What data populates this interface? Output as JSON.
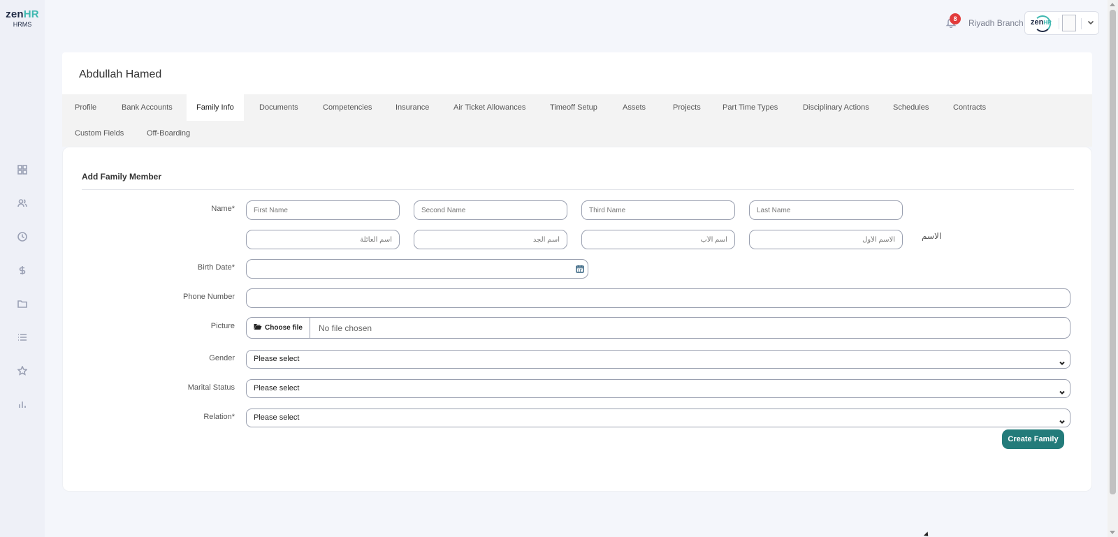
{
  "brand": {
    "logo_main": "zen",
    "logo_accent": "HR",
    "logo_sub": "HRMS"
  },
  "sidebar": {
    "icons": [
      {
        "name": "dashboard-icon"
      },
      {
        "name": "people-icon"
      },
      {
        "name": "clock-icon"
      },
      {
        "name": "dollar-icon"
      },
      {
        "name": "folder-icon"
      },
      {
        "name": "list-icon"
      },
      {
        "name": "star-icon"
      },
      {
        "name": "bar-chart-icon"
      }
    ]
  },
  "topbar": {
    "notification_count": "8",
    "branch": "Riyadh Branch",
    "company_logo_main": "zen",
    "company_logo_accent": "HR"
  },
  "employee": {
    "name": "Abdullah Hamed"
  },
  "tabs": [
    {
      "label": "Profile"
    },
    {
      "label": "Bank Accounts"
    },
    {
      "label": "Family Info",
      "active": true
    },
    {
      "label": "Documents"
    },
    {
      "label": "Competencies"
    },
    {
      "label": "Insurance"
    },
    {
      "label": "Air Ticket Allowances"
    },
    {
      "label": "Timeoff Setup"
    },
    {
      "label": "Assets"
    },
    {
      "label": "Projects"
    },
    {
      "label": "Part Time Types"
    },
    {
      "label": "Disciplinary Actions"
    },
    {
      "label": "Schedules"
    },
    {
      "label": "Contracts"
    },
    {
      "label": "Custom Fields"
    },
    {
      "label": "Off-Boarding"
    }
  ],
  "form": {
    "title": "Add Family Member",
    "name_label": "Name",
    "required_mark": "*",
    "name_placeholders_en": [
      "First Name",
      "Second Name",
      "Third Name",
      "Last Name"
    ],
    "name_placeholders_ar": [
      "اسم العائلة",
      "اسم الجد",
      "اسم الأب",
      "الاسم الأول"
    ],
    "arabic_name_label": "الاسم",
    "birth_date_label": "Birth Date",
    "birth_date_value": "",
    "phone_label": "Phone Number",
    "phone_value": "",
    "picture_label": "Picture",
    "file_button": "Choose file",
    "file_status": "No file chosen",
    "gender_label": "Gender",
    "gender_value": "Please select",
    "marital_label": "Marital Status",
    "marital_value": "Please select",
    "relation_label": "Relation",
    "relation_value": "Please select",
    "submit": "Create Family"
  },
  "colors": {
    "primary": "#237b7a",
    "accent": "#3fb8b0",
    "badge": "#e23b3b"
  }
}
